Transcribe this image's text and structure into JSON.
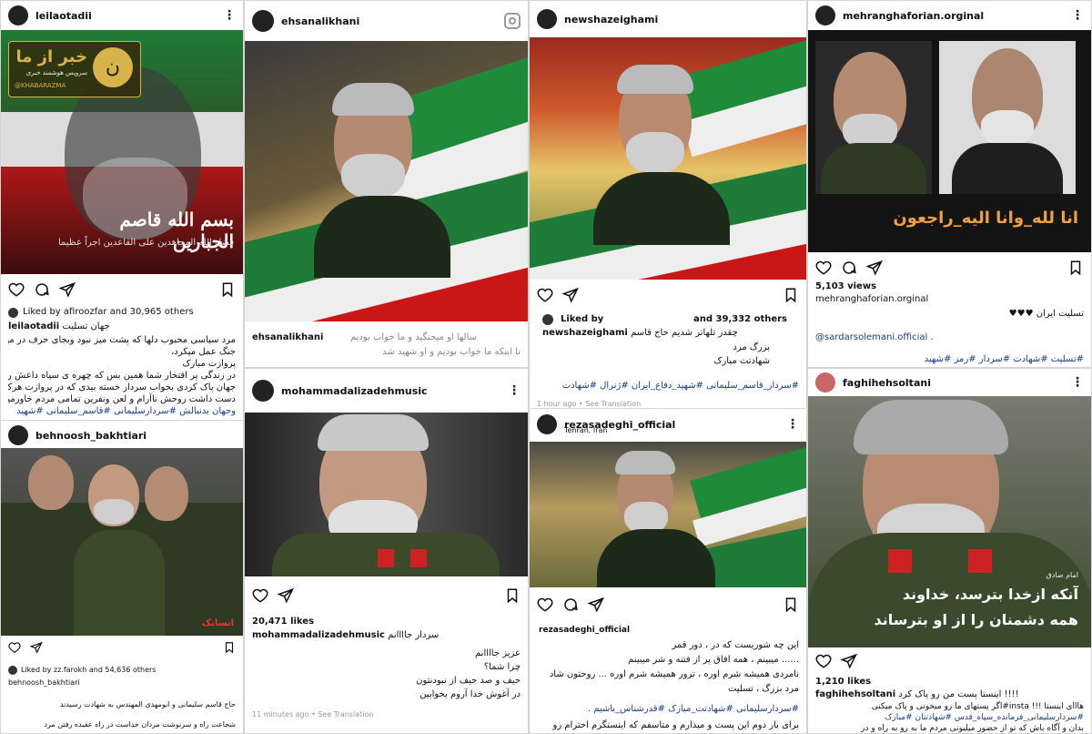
{
  "posts": {
    "p1": {
      "username": "leilaotadii",
      "watermark_name": "خبر از ما",
      "watermark_sub": "سرویس هوشمند خبری",
      "watermark_handle": "@KHABARAZMA",
      "image_text_main": "بسم الله قاصم الجبارین",
      "image_text_sub": "فضل الله المجاهدین علی القاعدین اجراً عظیما",
      "liked_by": "Liked by afiroozfar and 30,965 others",
      "caption_user": "leilaotadii",
      "caption_lines": [
        "مرد سیاسی محبوب دلها که پشت میز نبود وبجای حرف در میادین",
        "جنگ عمل میکرد،",
        "پروازت مبارک",
        "در زندگی پر افتخار شما همین بس که چهره ی سیاه داعش را از",
        "جهان پاک کردی بخواب سردار خسته بیدی که در پروازت هرکسی",
        "دست داشت روحش ناآرام و لعن ونفرین تمامی مردم خاورمیانه",
        "وجهان بدنبالش #سردارسلیمانی #قاسم_سلیمانی #شهید"
      ],
      "caption_first": "جهان تسلیت"
    },
    "p2": {
      "username": "behnoosh_bakhtiari",
      "liked_by": "Liked by zz.farokh and 54,636 others",
      "caption_user": "behnoosh_bakhtiari",
      "caption_lines": [
        "حاج قاسم سلیمانی و ابومهدی المهندس به شهادت رسیدند",
        "شجاعت راه و سرنوشت مردان خداست در راه عقیده رفتن مرد"
      ],
      "image_badge": "انسانک"
    },
    "p3": {
      "username": "ehsanalikhani",
      "caption_user": "ehsanalikhani",
      "caption_lines": [
        "سالها او میجنگید و ما خواب بودیم",
        "تا اینکه ما خواب بودیم و او شهید شد"
      ]
    },
    "p4": {
      "username": "mohammadalizadehmusic",
      "likes": "20,471 likes",
      "caption_user": "mohammadalizadehmusic",
      "caption_first": "سردار جاااانم",
      "caption_lines": [
        "عزیز جاااانم",
        "چرا شما؟",
        "حیف و صد حیف از نبودنتون",
        "در آغوش خدا آروم بخوابین"
      ],
      "time": "11 minutes ago",
      "see_translation": "See Translation"
    },
    "p5": {
      "username": "newshazeighami",
      "liked_by_prefix": "Liked by",
      "liked_by_suffix": "and 39,332 others",
      "caption_user": "newshazeighami",
      "caption_first": "چقدر تلهاتر شدیم حاج قاسم",
      "caption_lines": [
        "بزرگ مرد",
        "شهادتت مبارک",
        "#سردار_قاسم_سلیمانی #شهید_دفاع_ایران #ژنرال #شهادت"
      ],
      "time": "1 hour ago",
      "see_translation": "See Translation"
    },
    "p6": {
      "username": "rezasadeghi_official",
      "location": "Tehran, Iran",
      "caption_user": "rezasadeghi_official",
      "caption_first": "این چه شوریست که در ، دور قمر",
      "caption_lines": [
        "...... میبینم ، همه افاق پر از فتنه و شر میبینم",
        "نامردی همیشه شرم اوره ، ترور همیشه شرم اوره ... روحتون شاد",
        "مرد بزرگ ، تسلیت",
        "#سردارسلیمانی #شهادتت_مبارک #قدرشناس_باشیم .",
        "برای بار دوم این پست و میذارم و متاسفم که اینستگرم احترام رو"
      ]
    },
    "p7": {
      "username": "mehranghaforian.orginal",
      "image_text": "انا لله_وانا اليه_راجعون",
      "views": "5,103 views",
      "caption_user": "mehranghaforian.orginal",
      "caption_lines": [
        "تسلیت ایران",
        "@sardarsolemani.official .",
        "#تسلیت #شهادت #سردار #رمز #شهید"
      ]
    },
    "p8": {
      "username": "faghihehsoltani",
      "image_text_1": "آنکه ازخدا بترسد، خداوند",
      "image_text_2": "همه دشمنان را از او بترساند",
      "image_text_top": "امام صادق",
      "likes": "1,210 likes",
      "caption_user": "faghihehsoltani",
      "caption_first": "اینستا پست من رو پاک کرد !!!!",
      "caption_lines": [
        "هااای اینستا !!! insta#اگر پستهای ما رو میخونی و پاک میکنی",
        "#سردارسلیمانی_فرمانده_سپاه_قدس #شهادتتان #مبارک",
        "بدان و آگاه باش که تو از حضور میلیونی مردم ما به رو به راه و در"
      ]
    }
  },
  "colors": {
    "flag_green": "#239f40",
    "flag_red": "#da0000",
    "uniform_green": "#3b4a2c",
    "watermark_gold": "#d8b24a",
    "link_blue": "#1a3d8f"
  },
  "icons": [
    "heart-icon",
    "comment-icon",
    "share-icon",
    "bookmark-icon",
    "more-icon",
    "instagram-icon"
  ]
}
